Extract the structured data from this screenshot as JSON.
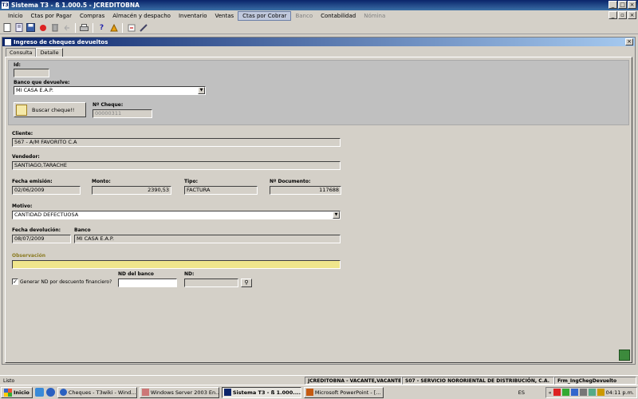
{
  "window": {
    "title": "Sistema T3 - ß 1.000.5 - JCREDITOBNA",
    "icon_text": "T3"
  },
  "menu": [
    "Inicio",
    "Ctas por Pagar",
    "Compras",
    "Almacén y despacho",
    "Inventario",
    "Ventas",
    "Ctas por Cobrar",
    "Banco",
    "Contabilidad",
    "Nómina"
  ],
  "menu_active": "Ctas por Cobrar",
  "menu_disabled": [
    "Banco",
    "Nómina"
  ],
  "toolbar_icons": [
    "new-icon",
    "open-icon",
    "save-icon",
    "record-icon",
    "delete-icon",
    "undo-icon",
    "print-icon",
    "help-icon",
    "pointer-icon",
    "close-doc-icon",
    "tool-icon"
  ],
  "child": {
    "title": "Ingreso de cheques devueltos",
    "tabs": [
      "Consulta",
      "Detalle"
    ],
    "selected_tab": "Detalle"
  },
  "form": {
    "id_label": "Id:",
    "id_value": "",
    "banco_label": "Banco que devuelve:",
    "banco_value": "MI CASA E.A.P.",
    "buscar_label": "Buscar cheque!!",
    "ncheque_label": "Nº Cheque:",
    "ncheque_value": "00000311",
    "cliente_label": "Cliente:",
    "cliente_value": "567 - A/M FAVORITO C.A",
    "vendedor_label": "Vendedor:",
    "vendedor_value": "SANTIAGO,TARACHE",
    "fecha_emision_label": "Fecha emisión:",
    "fecha_emision_value": "02/06/2009",
    "monto_label": "Monto:",
    "monto_value": "2390,53",
    "tipo_label": "Tipo:",
    "tipo_value": "FACTURA",
    "ndoc_label": "Nº Documento:",
    "ndoc_value": "117688",
    "motivo_label": "Motivo:",
    "motivo_value": "CANTIDAD DEFECTUOSA",
    "fecha_dev_label": "Fecha devolución:",
    "fecha_dev_value": "08/07/2009",
    "banco2_label": "Banco",
    "banco2_value": "MI CASA E.A.P.",
    "observacion_label": "Observación",
    "observacion_value": "",
    "generar_label": "Generar ND por descuento financiero?",
    "generar_checked": "✓",
    "nd_banco_label": "ND del banco",
    "nd_banco_value": "",
    "nd_label": "ND:",
    "nd_value": ""
  },
  "status": {
    "left": "Listo",
    "user": "JCREDITOBNA - VACANTE,VACANTE",
    "company": "S07 - SERVICIO NORORIENTAL DE DISTRIBUCIÓN, C.A.",
    "form": "Frm_IngChegDevuelto"
  },
  "taskbar": {
    "start": "Inicio",
    "tasks": [
      "Cheques - T3wiki - Wind...",
      "Windows Server 2003 En...",
      "Sistema T3 - ß 1.000....",
      "Microsoft PowerPoint - [..."
    ],
    "active_task": "Sistema T3 - ß 1.000....",
    "lang": "ES",
    "clock": "04:11 p.m."
  },
  "colors": {
    "title_blue": "#0a246a",
    "observation_yellow": "#f0e68c"
  }
}
